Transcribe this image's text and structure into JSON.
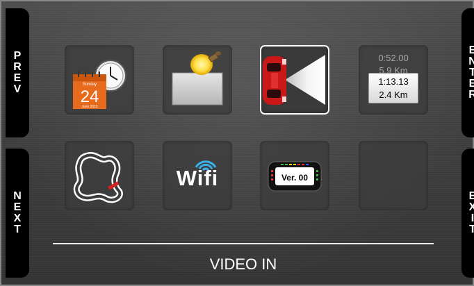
{
  "side_buttons": {
    "prev": "PREV",
    "next": "NEXT",
    "enter": "ENTER",
    "exit": "EXIT"
  },
  "tiles": [
    {
      "id": "date-time",
      "icon": "calendar-clock-icon",
      "calendar_weekday": "Sunday",
      "calendar_day": "24",
      "calendar_month": "June 2015"
    },
    {
      "id": "backlight",
      "icon": "lamp-lightbulb-icon"
    },
    {
      "id": "video-in",
      "icon": "car-camera-icon",
      "selected": true
    },
    {
      "id": "lap-time",
      "icon": "lap-time-distance-icon",
      "faded_time": "0:52.00",
      "faded_distance": "5.9 Km",
      "time": "1:13.13",
      "distance": "2.4 Km"
    },
    {
      "id": "tracks",
      "icon": "race-track-icon"
    },
    {
      "id": "wifi",
      "icon": "wifi-icon",
      "label": "Wifi"
    },
    {
      "id": "firmware",
      "icon": "dash-display-icon",
      "version": "Ver. 00"
    },
    {
      "id": "empty",
      "icon": ""
    }
  ],
  "selected_label": "VIDEO IN",
  "colors": {
    "accent_red": "#d42020",
    "calendar_orange": "#e86a1c",
    "wifi_blue": "#3ab0e8"
  }
}
